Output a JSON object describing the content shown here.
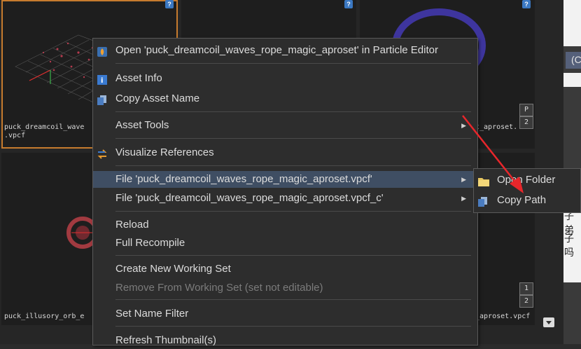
{
  "thumbnails": [
    {
      "name": "puck_dreamcoil_wave\n.vpcf",
      "selected": true
    },
    {
      "name": "",
      "selected": false
    },
    {
      "name": "",
      "selected": false
    },
    {
      "name": "puck_illusory_orb_e",
      "selected": false
    }
  ],
  "thumb_right_labels": {
    "top": "t_aproset.",
    "bottom": "_aproset.vpcf"
  },
  "side_badges": {
    "b1": "P",
    "b2": "2",
    "b3": "1",
    "b4": "2"
  },
  "right_panel": {
    "text1": "(C",
    "text2": "子弟",
    "text3": "子吗"
  },
  "menu": {
    "open_in_editor": "Open 'puck_dreamcoil_waves_rope_magic_aproset' in Particle Editor",
    "asset_info": "Asset Info",
    "copy_asset_name": "Copy Asset Name",
    "asset_tools": "Asset Tools",
    "visualize_references": "Visualize References",
    "file_vpcf": "File 'puck_dreamcoil_waves_rope_magic_aproset.vpcf'",
    "file_vpcf_c": "File 'puck_dreamcoil_waves_rope_magic_aproset.vpcf_c'",
    "reload": "Reload",
    "full_recompile": "Full Recompile",
    "create_working_set": "Create New Working Set",
    "remove_working_set": "Remove From Working Set (set not editable)",
    "set_name_filter": "Set Name Filter",
    "refresh_thumbnail": "Refresh Thumbnail(s)"
  },
  "submenu": {
    "open_folder": "Open Folder",
    "copy_path": "Copy Path"
  },
  "colors": {
    "highlight": "#3f4e63",
    "selection_border": "#c67b2e",
    "annotation_arrow": "#e8262b"
  }
}
